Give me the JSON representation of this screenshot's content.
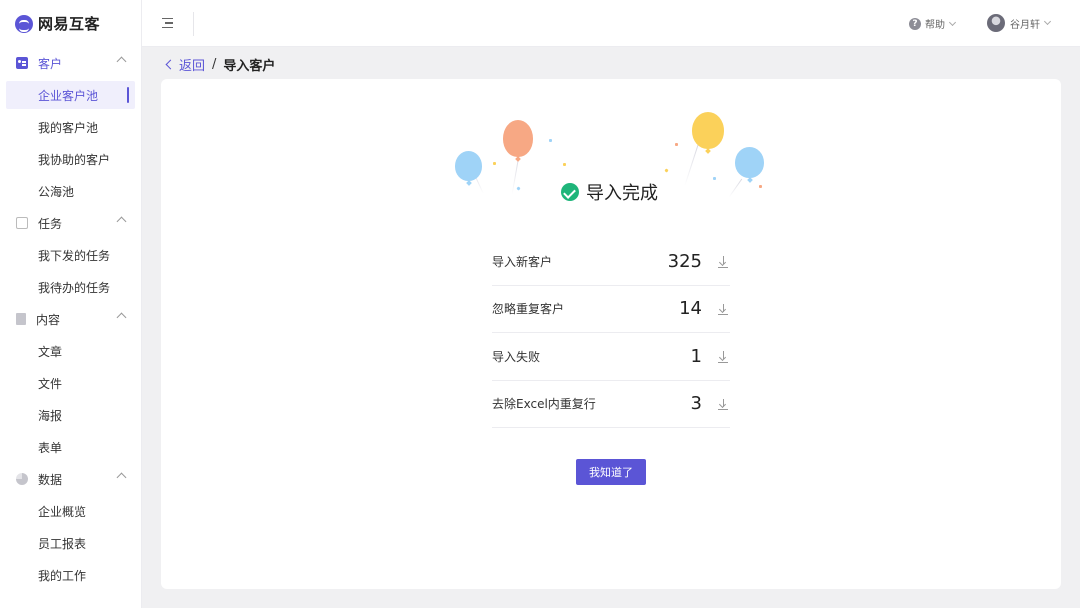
{
  "app": {
    "logo_text": "网易互客"
  },
  "sidebar": {
    "groups": [
      {
        "label": "客户",
        "icon": "customer-card-icon",
        "items": [
          "企业客户池",
          "我的客户池",
          "我协助的客户",
          "公海池"
        ]
      },
      {
        "label": "任务",
        "icon": "task-icon",
        "items": [
          "我下发的任务",
          "我待办的任务"
        ]
      },
      {
        "label": "内容",
        "icon": "document-icon",
        "items": [
          "文章",
          "文件",
          "海报",
          "表单"
        ]
      },
      {
        "label": "数据",
        "icon": "pie-chart-icon",
        "items": [
          "企业概览",
          "员工报表",
          "我的工作"
        ]
      }
    ],
    "active_item": "企业客户池"
  },
  "topbar": {
    "help_label": "帮助",
    "user_name": "谷月轩"
  },
  "breadcrumb": {
    "back_label": "返回",
    "separator": "/",
    "current": "导入客户"
  },
  "result": {
    "title": "导入完成",
    "stats": [
      {
        "label": "导入新客户",
        "value": "325"
      },
      {
        "label": "忽略重复客户",
        "value": "14"
      },
      {
        "label": "导入失败",
        "value": "1"
      },
      {
        "label": "去除Excel内重复行",
        "value": "3"
      }
    ],
    "confirm_label": "我知道了"
  },
  "colors": {
    "accent": "#5b55d6",
    "success": "#1fb57a"
  }
}
